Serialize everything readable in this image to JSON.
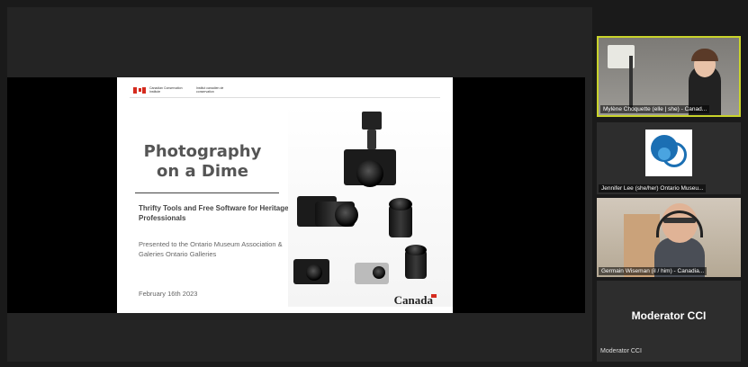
{
  "slide": {
    "agency_en": "Canadian Conservation Institute",
    "agency_fr": "Institut canadien de conservation",
    "title_line1": "Photography",
    "title_line2": "on a Dime",
    "subtitle": "Thrifty Tools and Free Software for Heritage Professionals",
    "presented": "Presented to the Ontario Museum Association & Galeries Ontario Galleries",
    "date": "February 16th 2023",
    "wordmark": "Canada"
  },
  "participants": [
    {
      "name": "Mylène Choquette (elle | she) - Canad...",
      "active": true
    },
    {
      "name": "Jennifer Lee (she/her) Ontario Museu..."
    },
    {
      "name": "Germain Wiseman (il / him) - Canadia..."
    },
    {
      "name": "Moderator CCI",
      "display_name": "Moderator CCI"
    }
  ],
  "colors": {
    "active_border": "#c9d32a",
    "tile_bg": "#2d2d2d",
    "logo_blue": "#1b6fb3"
  }
}
